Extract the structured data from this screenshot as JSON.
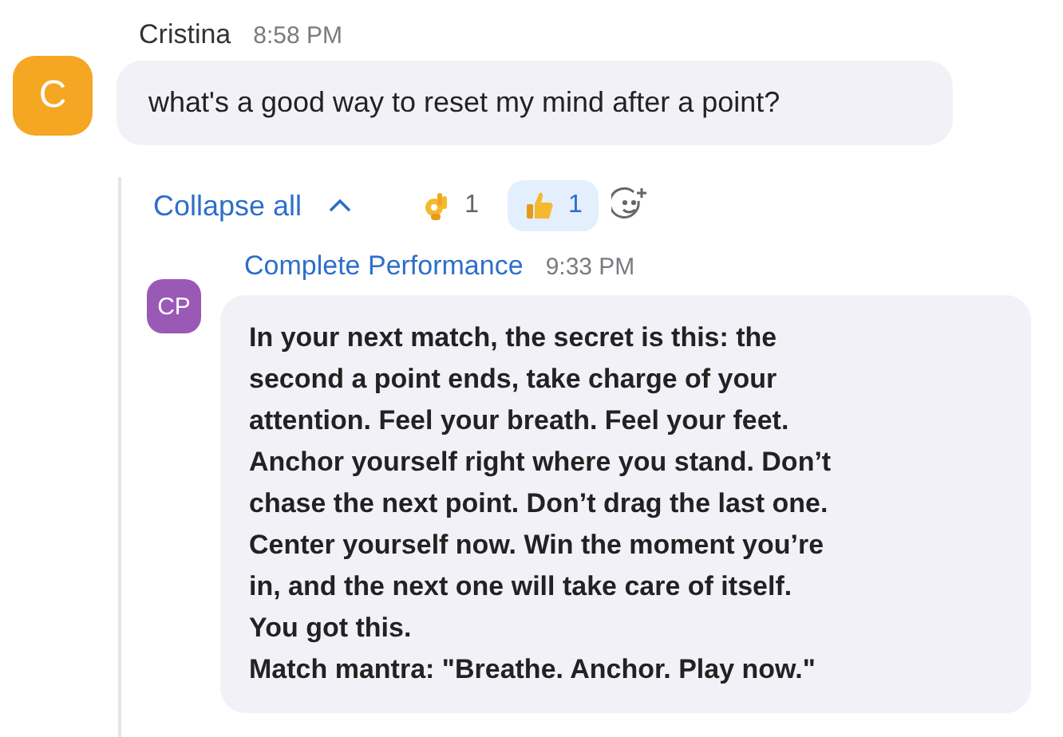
{
  "message": {
    "sender": "Cristina",
    "time": "8:58 PM",
    "avatar": "C",
    "text": "what's a good way to reset my mind after a point?"
  },
  "thread_controls": {
    "collapse_label": "Collapse all",
    "reactions": [
      {
        "kind": "ok-hand",
        "count": "1",
        "selected": false
      },
      {
        "kind": "thumbs-up",
        "count": "1",
        "selected": true
      }
    ]
  },
  "reply": {
    "sender": "Complete Performance",
    "time": "9:33 PM",
    "avatar": "CP",
    "text": "In your next match, the secret is this: the\nsecond a point ends, take charge of your\nattention. Feel your breath. Feel your feet.\nAnchor yourself right where you stand. Don’t\nchase the next point. Don’t drag the last one.\nCenter yourself now. Win the moment you’re\nin, and the next one will take care of itself.\nYou got this.\nMatch mantra: \"Breathe. Anchor. Play now.\""
  }
}
